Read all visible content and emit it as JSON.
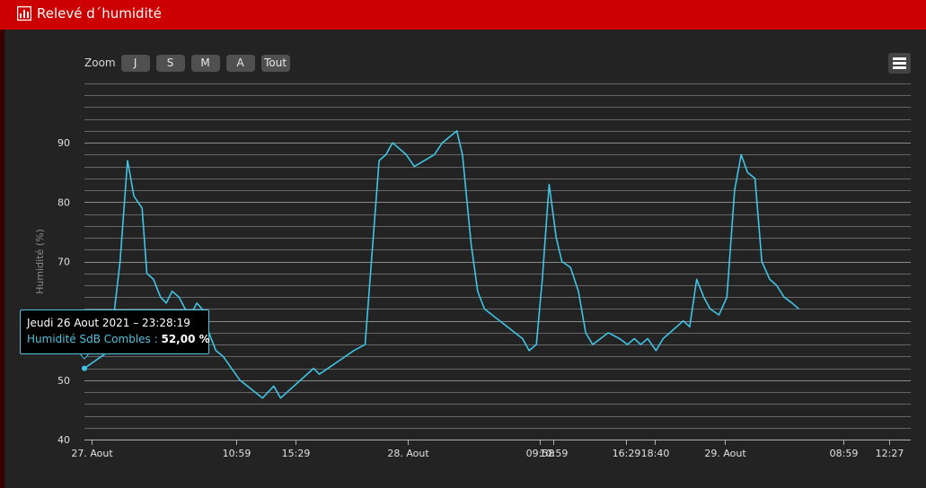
{
  "header": {
    "title": "Relevé d´humidité",
    "background": "#cc0000"
  },
  "zoom": {
    "label": "Zoom",
    "buttons": [
      "J",
      "S",
      "M",
      "A",
      "Tout"
    ]
  },
  "menu": {
    "icon": "hamburger-menu-icon"
  },
  "tooltip": {
    "date": "Jeudi 26 Aout 2021 – 23:28:19",
    "series": "Humidité SdB Combles",
    "separator": " : ",
    "value": "52,00 %"
  },
  "chart_data": {
    "type": "line",
    "title": "",
    "xlabel": "",
    "ylabel": "Humidité (%)",
    "ylim": [
      40,
      100
    ],
    "yticks": [
      40,
      50,
      60,
      70,
      80,
      90
    ],
    "ytick_labels": [
      "40",
      "50",
      "60",
      "70",
      "80",
      "90"
    ],
    "grid": true,
    "line_color": "#40c4e4",
    "xlim": [
      "2021-08-26 23:28",
      "2021-08-29 14:05"
    ],
    "xticks": [
      {
        "t": "2021-08-27 00:00",
        "label": "27. Aout"
      },
      {
        "t": "2021-08-27 10:59",
        "label": "10:59"
      },
      {
        "t": "2021-08-27 15:29",
        "label": "15:29"
      },
      {
        "t": "2021-08-28 00:00",
        "label": "28. Aout"
      },
      {
        "t": "2021-08-28 09:58",
        "label": "09:58"
      },
      {
        "t": "2021-08-28 10:59",
        "label": "10:59"
      },
      {
        "t": "2021-08-28 16:29",
        "label": "16:29"
      },
      {
        "t": "2021-08-28 18:40",
        "label": "18:40"
      },
      {
        "t": "2021-08-29 00:00",
        "label": "29. Aout"
      },
      {
        "t": "2021-08-29 08:59",
        "label": "08:59"
      },
      {
        "t": "2021-08-29 12:27",
        "label": "12:27"
      }
    ],
    "series": [
      {
        "name": "Humidité SdB Combles",
        "points": [
          [
            "2021-08-26 23:28",
            52
          ],
          [
            "2021-08-27 01:23",
            55
          ],
          [
            "2021-08-27 02:10",
            70
          ],
          [
            "2021-08-27 02:44",
            87
          ],
          [
            "2021-08-27 03:13",
            81
          ],
          [
            "2021-08-27 03:50",
            79
          ],
          [
            "2021-08-27 04:12",
            68
          ],
          [
            "2021-08-27 04:42",
            67
          ],
          [
            "2021-08-27 05:14",
            64
          ],
          [
            "2021-08-27 05:40",
            63
          ],
          [
            "2021-08-27 06:07",
            65
          ],
          [
            "2021-08-27 06:38",
            64
          ],
          [
            "2021-08-27 07:06",
            62
          ],
          [
            "2021-08-27 07:32",
            61
          ],
          [
            "2021-08-27 07:59",
            63
          ],
          [
            "2021-08-27 08:23",
            62
          ],
          [
            "2021-08-27 08:54",
            58
          ],
          [
            "2021-08-27 09:26",
            55
          ],
          [
            "2021-08-27 09:59",
            54
          ],
          [
            "2021-08-27 11:15",
            50
          ],
          [
            "2021-08-27 12:58",
            47
          ],
          [
            "2021-08-27 13:49",
            49
          ],
          [
            "2021-08-27 14:20",
            47
          ],
          [
            "2021-08-27 16:50",
            52
          ],
          [
            "2021-08-27 17:16",
            51
          ],
          [
            "2021-08-27 19:14",
            54
          ],
          [
            "2021-08-27 19:53",
            55
          ],
          [
            "2021-08-27 20:44",
            56
          ],
          [
            "2021-08-27 21:48",
            87
          ],
          [
            "2021-08-27 22:19",
            88
          ],
          [
            "2021-08-27 22:49",
            90
          ],
          [
            "2021-08-27 23:51",
            88
          ],
          [
            "2021-08-28 00:28",
            86
          ],
          [
            "2021-08-28 01:59",
            88
          ],
          [
            "2021-08-28 02:35",
            90
          ],
          [
            "2021-08-28 03:41",
            92
          ],
          [
            "2021-08-28 04:07",
            88
          ],
          [
            "2021-08-28 04:46",
            73
          ],
          [
            "2021-08-28 05:16",
            65
          ],
          [
            "2021-08-28 05:47",
            62
          ],
          [
            "2021-08-28 08:40",
            57
          ],
          [
            "2021-08-28 09:10",
            55
          ],
          [
            "2021-08-28 09:43",
            56
          ],
          [
            "2021-08-28 10:10",
            67
          ],
          [
            "2021-08-28 10:41",
            83
          ],
          [
            "2021-08-28 11:13",
            74
          ],
          [
            "2021-08-28 11:39",
            70
          ],
          [
            "2021-08-28 12:18",
            69
          ],
          [
            "2021-08-28 12:54",
            65
          ],
          [
            "2021-08-28 13:27",
            58
          ],
          [
            "2021-08-28 13:59",
            56
          ],
          [
            "2021-08-28 15:10",
            58
          ],
          [
            "2021-08-28 16:01",
            57
          ],
          [
            "2021-08-28 16:37",
            56
          ],
          [
            "2021-08-28 17:08",
            57
          ],
          [
            "2021-08-28 17:37",
            56
          ],
          [
            "2021-08-28 18:09",
            57
          ],
          [
            "2021-08-28 18:47",
            55
          ],
          [
            "2021-08-28 19:19",
            57
          ],
          [
            "2021-08-28 20:51",
            60
          ],
          [
            "2021-08-28 21:20",
            59
          ],
          [
            "2021-08-28 21:52",
            67
          ],
          [
            "2021-08-28 22:24",
            64
          ],
          [
            "2021-08-28 22:53",
            62
          ],
          [
            "2021-08-28 23:33",
            61
          ],
          [
            "2021-08-29 00:09",
            64
          ],
          [
            "2021-08-29 00:44",
            82
          ],
          [
            "2021-08-29 01:14",
            88
          ],
          [
            "2021-08-29 01:43",
            85
          ],
          [
            "2021-08-29 02:17",
            84
          ],
          [
            "2021-08-29 02:48",
            70
          ],
          [
            "2021-08-29 03:24",
            67
          ],
          [
            "2021-08-29 03:55",
            66
          ],
          [
            "2021-08-29 04:29",
            64
          ],
          [
            "2021-08-29 05:05",
            63
          ],
          [
            "2021-08-29 05:36",
            62
          ]
        ]
      }
    ]
  }
}
